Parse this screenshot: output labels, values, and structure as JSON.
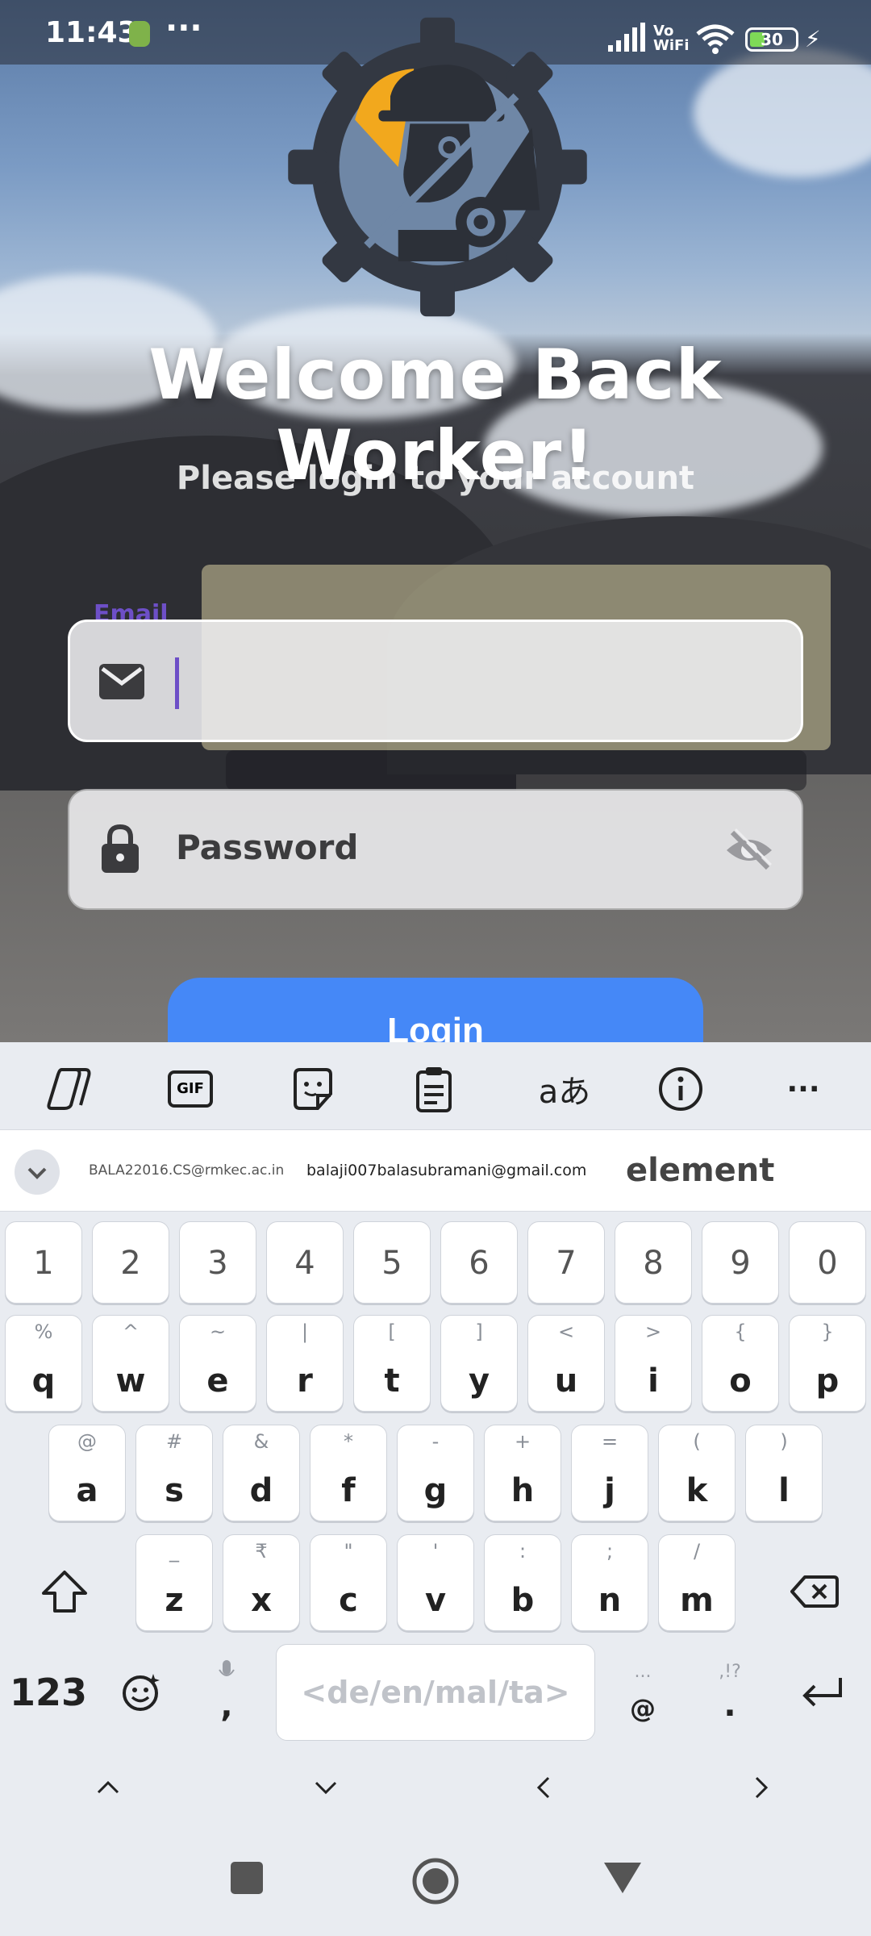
{
  "status_bar": {
    "time": "11:43",
    "more": "···",
    "network_label_top": "Vo",
    "network_label_bottom": "WiFi",
    "battery": "30",
    "colors": {
      "battery_fill": "#7ed957"
    }
  },
  "login": {
    "title": "Welcome Back Worker!",
    "subtitle": "Please login to your account",
    "email_label": "Email",
    "email_value": "",
    "password_placeholder": "Password",
    "login_button": "Login",
    "colors": {
      "accent": "#6d4fc7",
      "button": "#4588f7"
    }
  },
  "keyboard": {
    "toolbar": [
      "copilot-icon",
      "gif-icon",
      "sticker-icon",
      "clipboard-icon",
      "translate-icon",
      "info-icon",
      "more-icon"
    ],
    "gif_label": "GIF",
    "translate_label": "aあ",
    "more_label": "···",
    "suggestions": [
      "BALA22016.CS@rmkec.ac.in",
      "balaji007balasubramani@gmail.com",
      "element"
    ],
    "number_row": [
      "1",
      "2",
      "3",
      "4",
      "5",
      "6",
      "7",
      "8",
      "9",
      "0"
    ],
    "row1": [
      [
        "q",
        "%"
      ],
      [
        "w",
        "^"
      ],
      [
        "e",
        "~"
      ],
      [
        "r",
        "|"
      ],
      [
        "t",
        "["
      ],
      [
        "y",
        "]"
      ],
      [
        "u",
        "<"
      ],
      [
        "i",
        ">"
      ],
      [
        "o",
        "{"
      ],
      [
        "p",
        "}"
      ]
    ],
    "row2": [
      [
        "a",
        "@"
      ],
      [
        "s",
        "#"
      ],
      [
        "d",
        "&"
      ],
      [
        "f",
        "*"
      ],
      [
        "g",
        "-"
      ],
      [
        "h",
        "+"
      ],
      [
        "j",
        "="
      ],
      [
        "k",
        "("
      ],
      [
        "l",
        ")"
      ]
    ],
    "row3": [
      [
        "z",
        "_"
      ],
      [
        "x",
        "₹"
      ],
      [
        "c",
        "\""
      ],
      [
        "v",
        "'"
      ],
      [
        "b",
        ":"
      ],
      [
        "n",
        ";"
      ],
      [
        "m",
        "/"
      ]
    ],
    "symbols_key": "123",
    "comma_key": ",",
    "space_label": "<de/en/mal/ta>",
    "at_key": "@",
    "at_alt": "...",
    "period_key": ".",
    "period_alt": ",!?"
  }
}
